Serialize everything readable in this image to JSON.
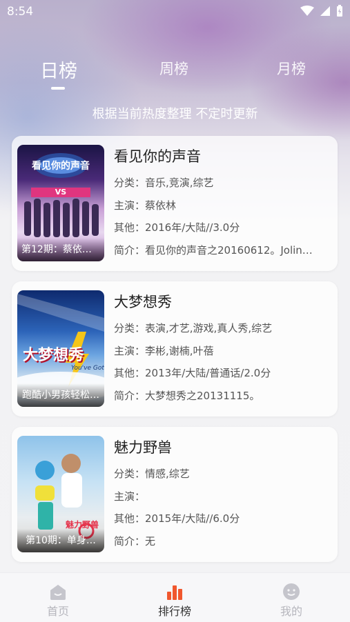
{
  "status": {
    "time": "8:54"
  },
  "tabs": [
    {
      "label": "日榜"
    },
    {
      "label": "周榜"
    },
    {
      "label": "月榜"
    }
  ],
  "subtitle": "根据当前热度整理 不定时更新",
  "labels": {
    "category": "分类：",
    "cast": "主演：",
    "other": "其他：",
    "intro": "简介："
  },
  "items": [
    {
      "title": "看见你的声音",
      "category": "音乐,竞演,综艺",
      "cast": "蔡依林",
      "other": "2016年/大陆//3.0分",
      "intro": "看见你的声音之20160612。Jolin…",
      "poster_caption": "第12期：蔡依林…",
      "poster_text": "看见你的声音",
      "poster_badge": "VS"
    },
    {
      "title": "大梦想秀",
      "category": "表演,才艺,游戏,真人秀,综艺",
      "cast": "李彬,谢楠,叶蓓",
      "other": "2013年/大陆/普通话/2.0分",
      "intro": "大梦想秀之20131115。",
      "poster_caption": "跑酷小男孩轻松…",
      "poster_text": "大梦想秀",
      "poster_badge": "You've Got"
    },
    {
      "title": "魅力野兽",
      "category": "情感,综艺",
      "cast": "",
      "other": "2015年/大陆//6.0分",
      "intro": "无",
      "poster_caption": "第10期：单身…",
      "poster_text": "魅力野兽"
    }
  ],
  "bottom_nav": [
    {
      "label": "首页"
    },
    {
      "label": "排行榜"
    },
    {
      "label": "我的"
    }
  ],
  "colors": {
    "accent": "#f0572e",
    "inactive": "#b6b6bd"
  }
}
